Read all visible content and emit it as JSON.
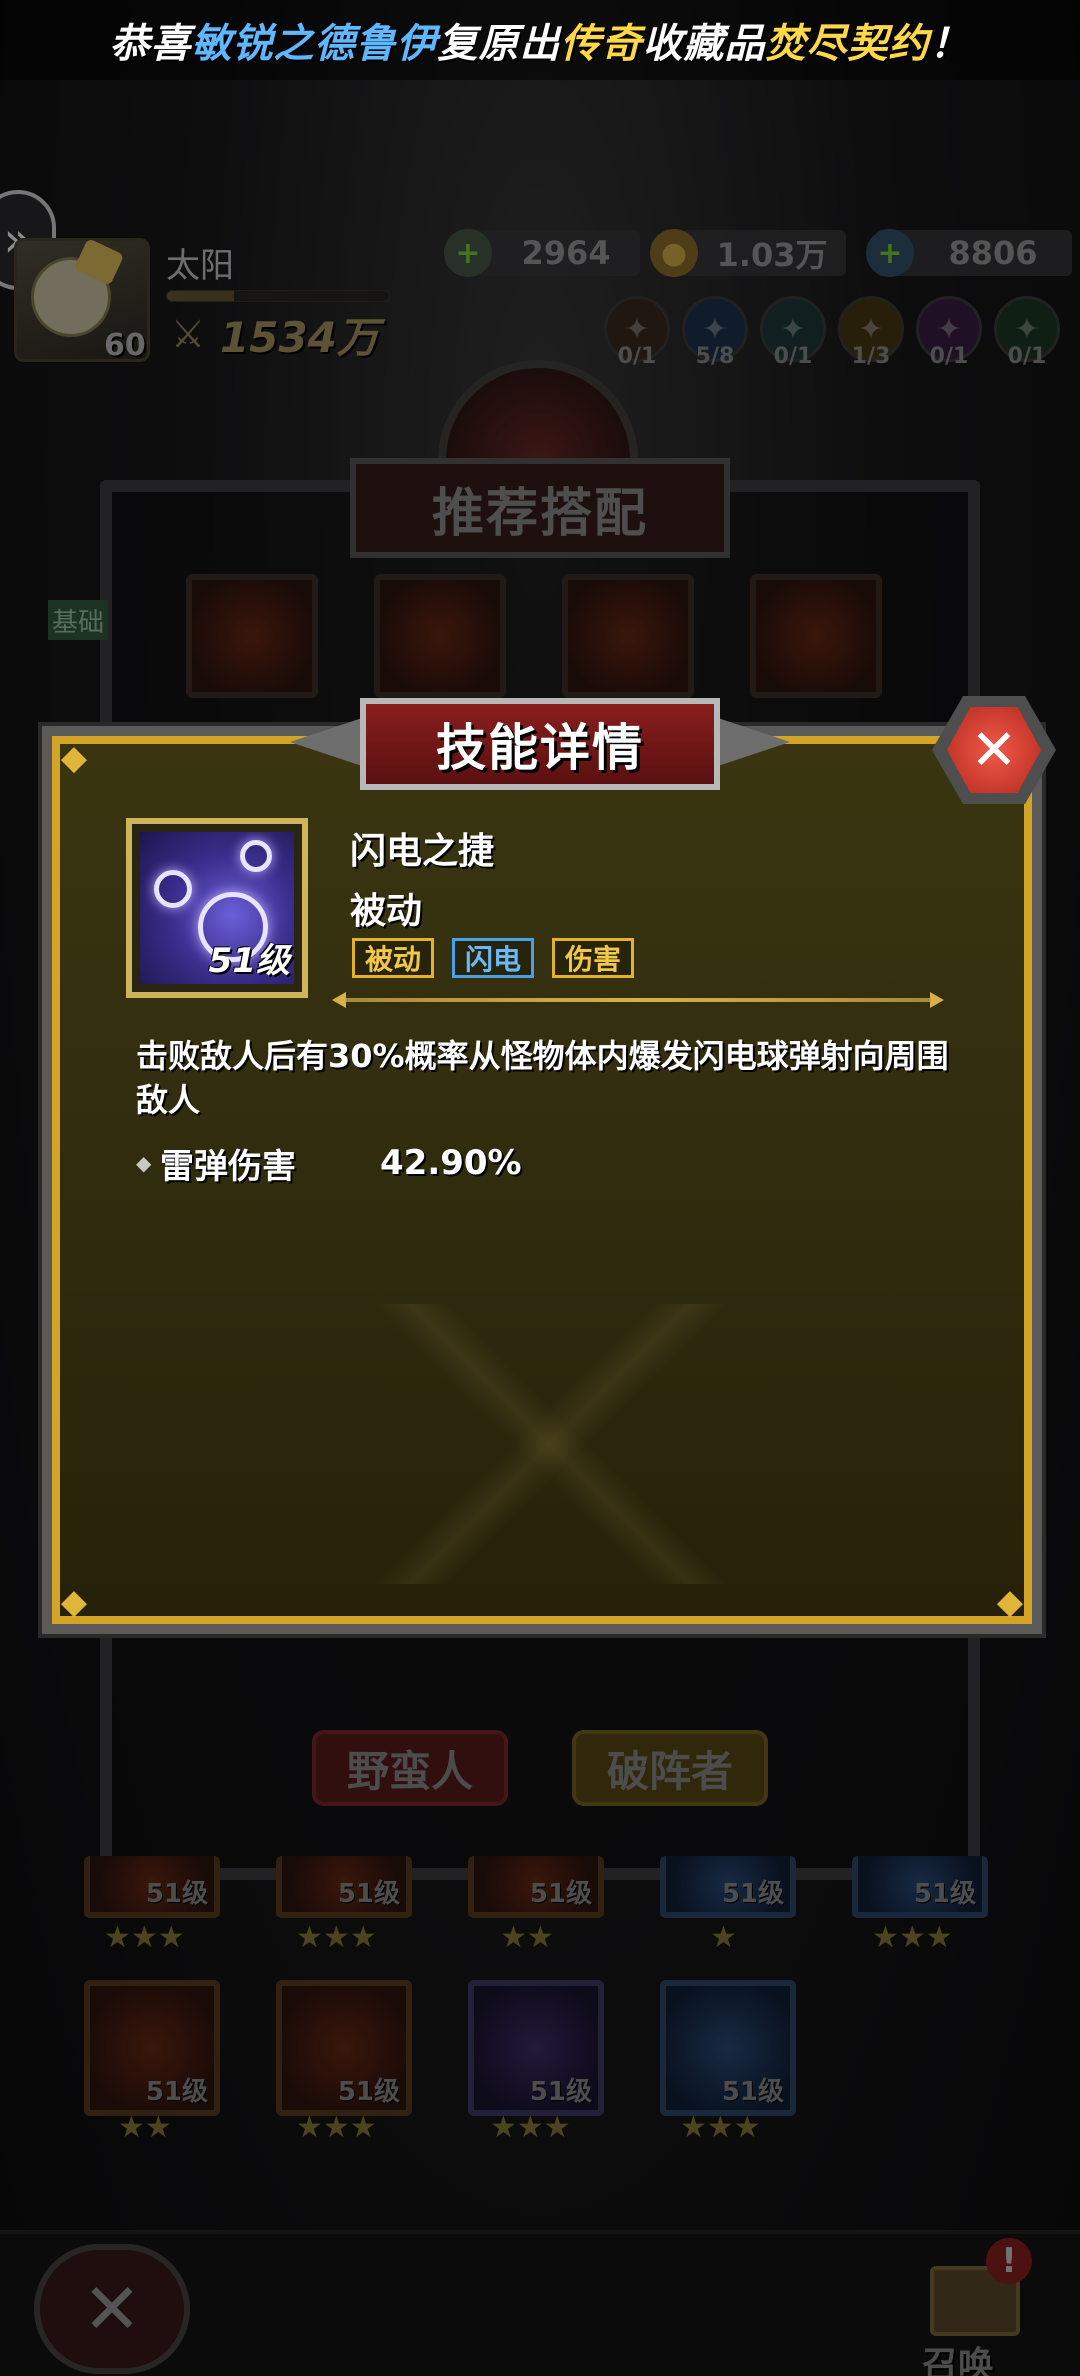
{
  "banner": {
    "part1": "恭喜",
    "player": "敏锐之德鲁伊",
    "part2": "复原出",
    "rarity": "传奇",
    "part3": "收藏品",
    "item": "焚尽契约",
    "part4": "！"
  },
  "player": {
    "name": "太阳",
    "level": "60",
    "power": "1534万",
    "xp_fraction": 0.3
  },
  "resources": [
    {
      "icon": "green-gem-icon",
      "value": "2964"
    },
    {
      "icon": "gold-coin-icon",
      "value": "1.03万"
    },
    {
      "icon": "blue-diamond-icon",
      "value": "8806"
    }
  ],
  "slots": [
    {
      "count": "0/1"
    },
    {
      "count": "5/8"
    },
    {
      "count": "0/1"
    },
    {
      "count": "1/3"
    },
    {
      "count": "0/1"
    },
    {
      "count": "0/1"
    }
  ],
  "background": {
    "panel_title": "推荐搭配",
    "side_tab": "基础",
    "button_red": "野蛮人",
    "button_yellow": "破阵者",
    "card_level": "51级",
    "summon_label": "召唤",
    "summon_badge": "!"
  },
  "modal": {
    "title": "技能详情",
    "skill_name": "闪电之捷",
    "skill_type": "被动",
    "icon_level": "51级",
    "tags": [
      "被动",
      "闪电",
      "伤害"
    ],
    "description": "击败敌人后有30%概率从怪物体内爆发闪电球弹射向周围敌人",
    "stat_label": "雷弹伤害",
    "stat_value": "42.90%"
  },
  "colors": {
    "frame_gold": "#d4a427",
    "title_red": "#8a1e1e",
    "tag_gold": "#f2c84a",
    "tag_blue": "#6ab8f8",
    "banner_blue": "#5fb8ff",
    "banner_gold": "#ffd84a"
  }
}
